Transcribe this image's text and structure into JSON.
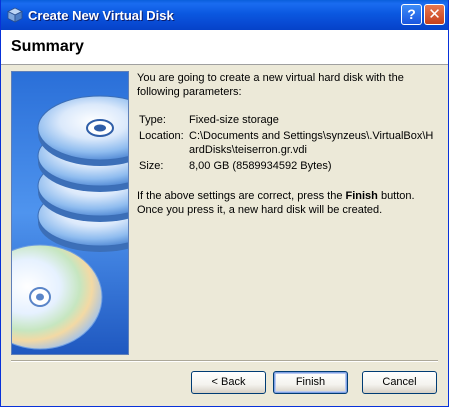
{
  "window": {
    "title": "Create New Virtual Disk",
    "help_label": "?",
    "close_label": "✕"
  },
  "header": {
    "title": "Summary"
  },
  "body": {
    "intro": "You are going to create a new virtual hard disk with the following parameters:",
    "params": [
      {
        "label": "Type:",
        "value": "Fixed-size storage"
      },
      {
        "label": "Location:",
        "value": "C:\\Documents and Settings\\synzeus\\.VirtualBox\\HardDisks\\teiserron.gr.vdi"
      },
      {
        "label": "Size:",
        "value": "8,00 GB (8589934592 Bytes)"
      }
    ],
    "outro_before": "If the above settings are correct, press the ",
    "outro_bold": "Finish",
    "outro_after": " button. Once you press it, a new hard disk will be created."
  },
  "buttons": {
    "back": "< Back",
    "finish": "Finish",
    "cancel": "Cancel"
  },
  "colors": {
    "titlebar": "#0849d2",
    "dialog_bg": "#ece9d8",
    "header_bg": "#ffffff"
  },
  "icons": {
    "title": "virtualbox-cube-icon",
    "side_image": "disks-illustration"
  }
}
